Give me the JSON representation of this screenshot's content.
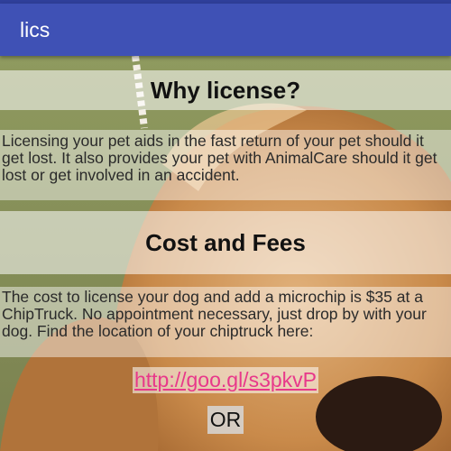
{
  "app_bar": {
    "title": "lics"
  },
  "sections": {
    "why": {
      "heading": "Why license?",
      "body": "Licensing your pet aids in the fast return of your pet should it get lost. It also provides your pet with AnimalCare should it get lost or get involved in an accident."
    },
    "cost": {
      "heading": "Cost and Fees",
      "body": "The cost to license your dog and add a microchip is $35 at a ChipTruck. No appointment necessary, just drop by with your dog. Find the location of your chiptruck here:"
    }
  },
  "link": {
    "text": "http://goo.gl/s3pkvP"
  },
  "separator": {
    "text": "OR"
  },
  "colors": {
    "app_bar": "#3f51b5",
    "link": "#e8388a"
  }
}
